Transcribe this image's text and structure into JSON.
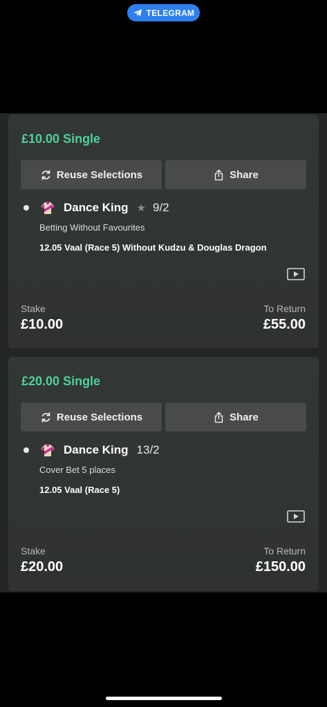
{
  "status_bar": {
    "telegram_label": "TELEGRAM"
  },
  "bets": [
    {
      "amount": "£10.00",
      "type": "Single",
      "reuse_label": "Reuse Selections",
      "share_label": "Share",
      "horse": "Dance King",
      "has_star": true,
      "odds": "9/2",
      "market": "Betting Without Favourites",
      "event": "12.05 Vaal (Race 5) Without Kudzu & Douglas Dragon",
      "stake_label": "Stake",
      "stake": "£10.00",
      "return_label": "To Return",
      "to_return": "£55.00"
    },
    {
      "amount": "£20.00",
      "type": "Single",
      "reuse_label": "Reuse Selections",
      "share_label": "Share",
      "horse": "Dance King",
      "has_star": false,
      "odds": "13/2",
      "market": "Cover Bet 5 places",
      "event": "12.05 Vaal (Race 5)",
      "stake_label": "Stake",
      "stake": "£20.00",
      "return_label": "To Return",
      "to_return": "£150.00"
    }
  ],
  "colors": {
    "accent_green": "#4fd19a",
    "telegram_blue": "#2f80ed",
    "card_bg": "#323735",
    "button_bg": "#484b4a"
  },
  "icons": [
    "telegram-icon",
    "refresh-icon",
    "share-icon",
    "jockey-silks-icon",
    "star-icon",
    "video-icon"
  ]
}
